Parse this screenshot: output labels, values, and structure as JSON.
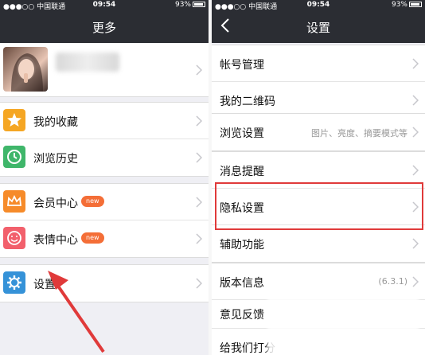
{
  "status": {
    "carrier": "●●●○○ 中国联通",
    "time": "09:54",
    "battery": "93%"
  },
  "left": {
    "title": "更多",
    "profile": {
      "name": "",
      "has_avatar": true
    },
    "items": [
      {
        "label": "我的收藏",
        "icon": "star-icon",
        "color": "#f5a623"
      },
      {
        "label": "浏览历史",
        "icon": "clock-icon",
        "color": "#3fb66a"
      },
      {
        "label": "会员中心",
        "icon": "crown-icon",
        "color": "#f68b2a",
        "badge": "new"
      },
      {
        "label": "表情中心",
        "icon": "smiley-icon",
        "color": "#f2606c",
        "badge": "new"
      },
      {
        "label": "设置",
        "icon": "gear-icon",
        "color": "#3592d8"
      }
    ]
  },
  "right": {
    "title": "设置",
    "items": [
      {
        "label": "帐号管理",
        "value": ""
      },
      {
        "label": "我的二维码",
        "value": ""
      },
      {
        "label": "浏览设置",
        "value": "图片、亮度、摘要模式等"
      },
      {
        "label": "消息提醒",
        "value": ""
      },
      {
        "label": "隐私设置",
        "value": ""
      },
      {
        "label": "辅助功能",
        "value": ""
      },
      {
        "label": "版本信息",
        "value": "(6.3.1)"
      },
      {
        "label": "意见反馈",
        "value": ""
      },
      {
        "label": "给我们打分",
        "value": ""
      }
    ]
  },
  "colors": {
    "navbar": "#2b2d33",
    "highlight": "#e03a3a",
    "arrow": "#e03a3a",
    "badge": "#f46e37"
  }
}
